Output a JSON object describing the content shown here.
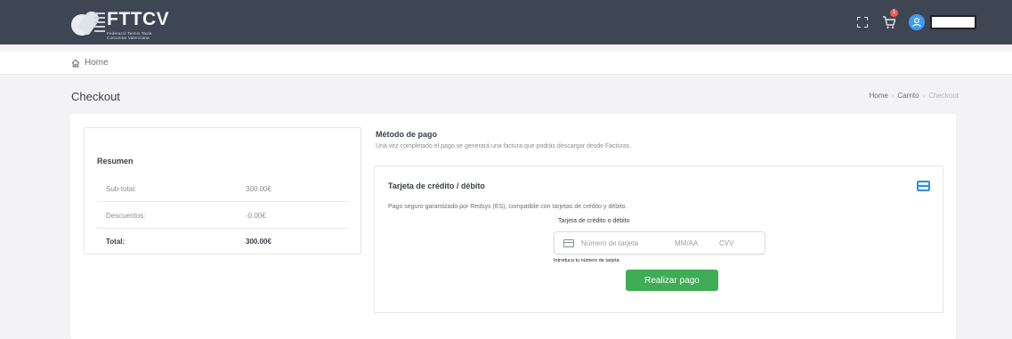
{
  "header": {
    "brand": "FTTCV",
    "brand_sub1": "Federació Tennis Taula",
    "brand_sub2": "Comunitat Valenciana",
    "cart_count": "1"
  },
  "nav": {
    "home_label": "Home"
  },
  "page": {
    "title": "Checkout",
    "breadcrumb": [
      "Home",
      "Carrito",
      "Checkout"
    ]
  },
  "summary": {
    "title": "Resumen",
    "rows": [
      {
        "label": "Sub-total:",
        "value": "300.00€"
      },
      {
        "label": "Descuentos:",
        "value": "-0.00€"
      },
      {
        "label": "Total:",
        "value": "300.00€"
      }
    ]
  },
  "payment": {
    "title": "Método de pago",
    "description": "Una vez completado el pago se generará una factura que podrás descargar desde Facturas.",
    "method_title": "Tarjeta de crédito / débito",
    "method_description": "Pago seguro garantizado por Redsys (ES), compatible con tarjetas de crédito y débito.",
    "field_label": "Tarjeta de crédito o débito",
    "card_number_placeholder": "Número de tarjeta",
    "expiry_placeholder": "MM/AA",
    "cvv_placeholder": "CVV",
    "helper_text": "Introduca tu número de tarjeta",
    "submit_label": "Realizar pago"
  },
  "colors": {
    "topbar": "#3e4553",
    "accent_blue": "#2f8fd8",
    "pay_button": "#3fad55",
    "badge": "#f15b5b"
  },
  "icons": [
    "expand-icon",
    "cart-icon",
    "user-avatar-icon",
    "home-icon",
    "credit-card-icon"
  ]
}
